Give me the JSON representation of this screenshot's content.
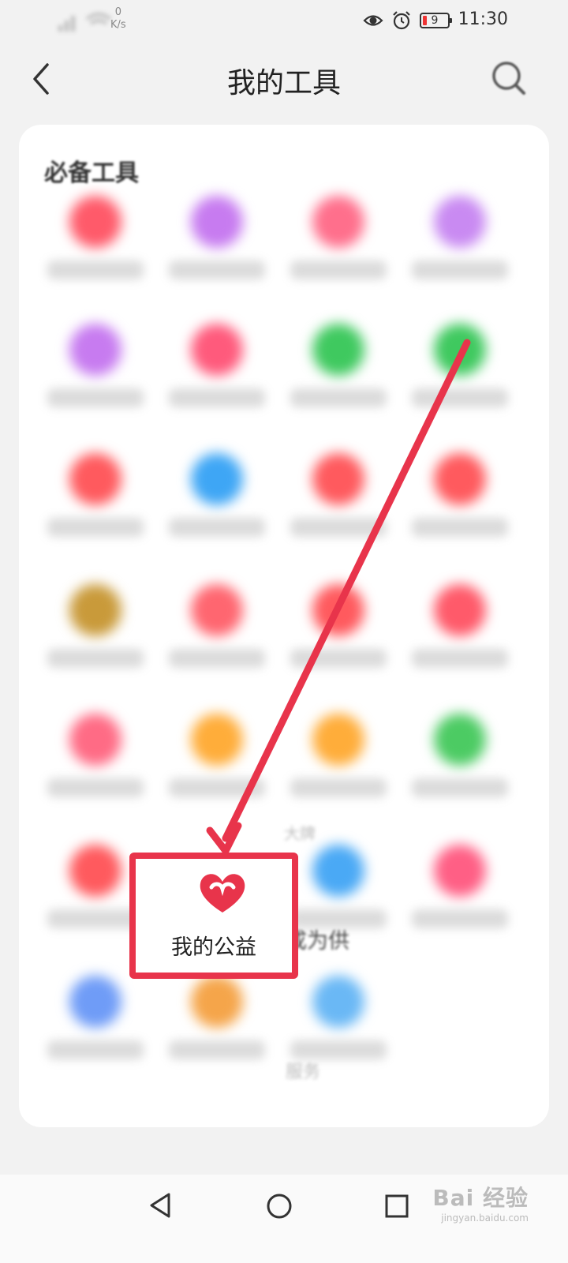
{
  "status_bar": {
    "net_speed_value": "0",
    "net_speed_unit": "K/s",
    "battery": "9",
    "time": "11:30"
  },
  "header": {
    "title": "我的工具"
  },
  "section": {
    "title": "必备工具"
  },
  "tools": [
    {
      "color": "#ff5a6a"
    },
    {
      "color": "#c77bf0"
    },
    {
      "color": "#ff6f8c"
    },
    {
      "color": "#c98af2"
    },
    {
      "color": "#c77bf0"
    },
    {
      "color": "#ff5a7c"
    },
    {
      "color": "#3fc95f"
    },
    {
      "color": "#3fc95f"
    },
    {
      "color": "#ff5a5e"
    },
    {
      "color": "#3ea6f5"
    },
    {
      "color": "#ff5a5e"
    },
    {
      "color": "#ff5a5e"
    },
    {
      "color": "#c99a3a"
    },
    {
      "color": "#ff6670"
    },
    {
      "color": "#ff5a5e"
    },
    {
      "color": "#ff5a6a"
    },
    {
      "color": "#ff6b85"
    },
    {
      "color": "#ffad3a"
    },
    {
      "color": "#ffad3a"
    },
    {
      "color": "#4ccb63"
    },
    {
      "color": "#ff5a5e"
    },
    {
      "color": "#ffffff"
    },
    {
      "color": "#4aa9f5"
    },
    {
      "color": "#ff5f85"
    },
    {
      "color": "#6f9cf7"
    },
    {
      "color": "#f5a54a"
    },
    {
      "color": "#6ab8f5"
    }
  ],
  "highlight": {
    "label": "我的公益",
    "accent": "#e8344b"
  },
  "peek": {
    "label": "成为供",
    "label_upper": "大牌",
    "label_lower": "服务"
  },
  "watermark": {
    "main": "Bai 经验",
    "sub": "jingyan.baidu.com"
  }
}
